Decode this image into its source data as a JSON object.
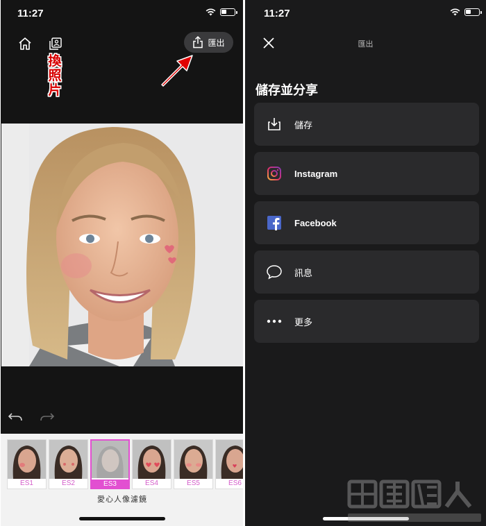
{
  "left": {
    "status": {
      "time": "11:27"
    },
    "annotation_label": "換照片",
    "export_label": "匯出",
    "filters": [
      {
        "label": "ES1"
      },
      {
        "label": "ES2"
      },
      {
        "label": "ES3"
      },
      {
        "label": "ES4"
      },
      {
        "label": "ES5"
      },
      {
        "label": "ES6"
      }
    ],
    "selected_filter": "ES3",
    "filter_caption": "愛心人像濾鏡",
    "accent_color": "#e24fd1"
  },
  "right": {
    "status": {
      "time": "11:27"
    },
    "title": "匯出",
    "heading": "儲存並分享",
    "options": [
      {
        "label": "儲存",
        "icon": "download-icon"
      },
      {
        "label": "Instagram",
        "icon": "instagram-icon"
      },
      {
        "label": "Facebook",
        "icon": "facebook-icon"
      },
      {
        "label": "訊息",
        "icon": "message-icon"
      },
      {
        "label": "更多",
        "icon": "more-icon"
      }
    ]
  },
  "watermark": {
    "text": "重灌狂人",
    "url": "http://briian.com"
  }
}
